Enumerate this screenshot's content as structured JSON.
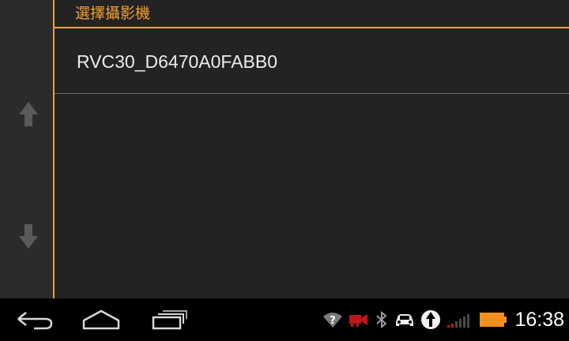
{
  "dialog": {
    "title": "選擇攝影機",
    "cameras": [
      {
        "label": "RVC30_D6470A0FABB0"
      }
    ]
  },
  "sidebar": {
    "icons": [
      "arrow-up-icon",
      "arrow-down-icon"
    ]
  },
  "nav_bar": {
    "buttons": [
      "back-icon",
      "home-icon",
      "recent-apps-icon"
    ]
  },
  "status_bar": {
    "icons": [
      "wifi-unknown-icon",
      "camera-alert-icon",
      "bluetooth-icon",
      "car-icon",
      "navigation-icon",
      "signal-bars-icon",
      "battery-icon"
    ],
    "time": "16:38",
    "colors": {
      "accent": "#f0a030",
      "camera_alert": "#c01818",
      "battery": "#f5901e"
    }
  }
}
